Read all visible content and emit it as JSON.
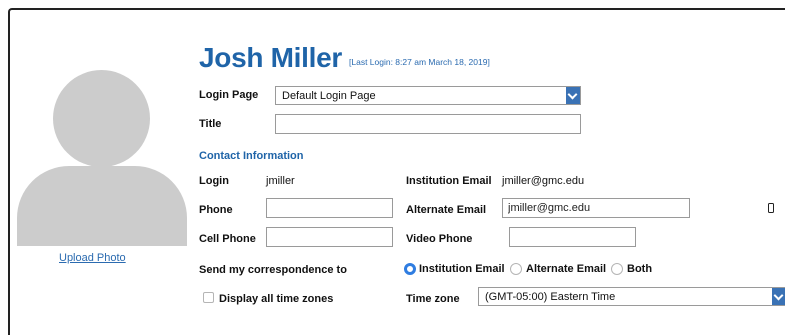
{
  "profile": {
    "name": "Josh Miller",
    "last_login": "[Last Login: 8:27 am March 18, 2019]",
    "upload_photo": "Upload Photo"
  },
  "login_page": {
    "label": "Login Page",
    "selected": "Default Login Page"
  },
  "title_field": {
    "label": "Title",
    "value": ""
  },
  "contact": {
    "section_title": "Contact Information",
    "login_label": "Login",
    "login_value": "jmiller",
    "institution_email_label": "Institution Email",
    "institution_email_value": "jmiller@gmc.edu",
    "phone_label": "Phone",
    "phone_value": "",
    "alternate_email_label": "Alternate Email",
    "alternate_email_value": "jmiller@gmc.edu",
    "cell_phone_label": "Cell Phone",
    "cell_phone_value": "",
    "video_phone_label": "Video Phone",
    "video_phone_value": ""
  },
  "correspondence": {
    "label": "Send my correspondence to",
    "options": [
      "Institution Email",
      "Alternate Email",
      "Both"
    ],
    "selected": "Institution Email"
  },
  "timezones": {
    "display_all_label": "Display all time zones",
    "display_all_checked": false,
    "label": "Time zone",
    "selected": "(GMT-05:00) Eastern Time"
  },
  "icons": {
    "device": "mobile-phone-icon",
    "select_arrow": "chevron-down-icon"
  },
  "colors": {
    "accent": "#1f64a8",
    "link": "#2b6bb0",
    "select_arrow_bg": "#3a72b5",
    "radio_on": "#2f7de1",
    "avatar": "#cccccc"
  }
}
